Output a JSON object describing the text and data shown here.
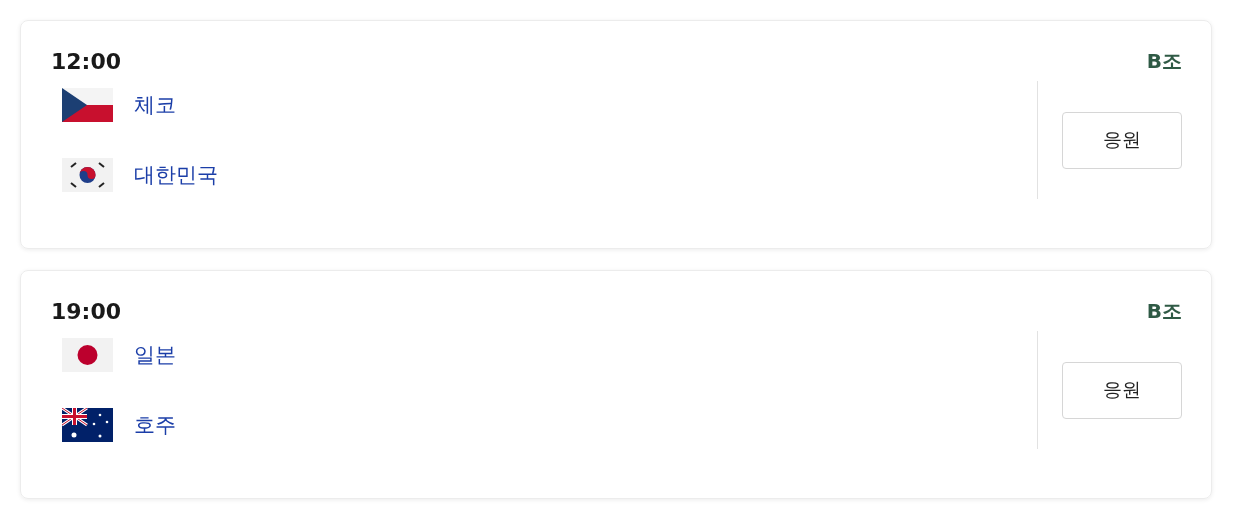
{
  "matches": [
    {
      "time": "12:00",
      "group": "B조",
      "teams": [
        {
          "name": "체코",
          "kind": "czech"
        },
        {
          "name": "대한민국",
          "kind": "korea"
        }
      ],
      "button": "응원"
    },
    {
      "time": "19:00",
      "group": "B조",
      "teams": [
        {
          "name": "일본",
          "kind": "japan"
        },
        {
          "name": "호주",
          "kind": "australia"
        }
      ],
      "button": "응원"
    }
  ]
}
